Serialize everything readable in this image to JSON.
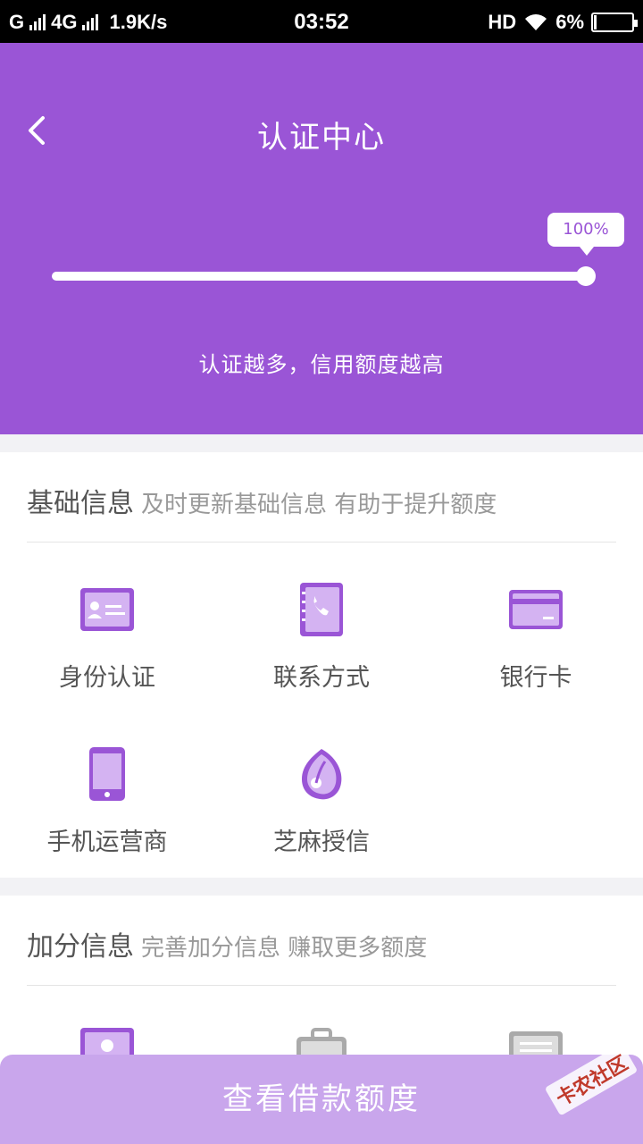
{
  "status_bar": {
    "carrier1": "G",
    "carrier2": "4G",
    "speed": "1.9K/s",
    "time": "03:52",
    "hd": "HD",
    "battery_text": "6%",
    "battery_level": 0.06
  },
  "header": {
    "title": "认证中心",
    "back_icon": "chevron-left-icon",
    "progress_label": "100%",
    "progress": 1.0,
    "subtitle": "认证越多，信用额度越高",
    "accent_color": "#9a55d6"
  },
  "basic": {
    "title": "基础信息",
    "hint": "及时更新基础信息 有助于提升额度",
    "items": [
      {
        "label": "身份认证",
        "icon": "id-card-icon"
      },
      {
        "label": "联系方式",
        "icon": "phone-book-icon"
      },
      {
        "label": "银行卡",
        "icon": "bank-card-icon"
      },
      {
        "label": "手机运营商",
        "icon": "mobile-phone-icon"
      },
      {
        "label": "芝麻授信",
        "icon": "sesame-credit-icon"
      }
    ]
  },
  "bonus": {
    "title": "加分信息",
    "hint": "完善加分信息 赚取更多额度",
    "items": [
      {
        "icon": "profile-card-icon"
      },
      {
        "icon": "briefcase-icon"
      },
      {
        "icon": "list-card-icon"
      }
    ]
  },
  "cta": {
    "label": "查看借款额度",
    "color": "#c9a6ec"
  },
  "watermark": {
    "text": "卡农社区"
  }
}
